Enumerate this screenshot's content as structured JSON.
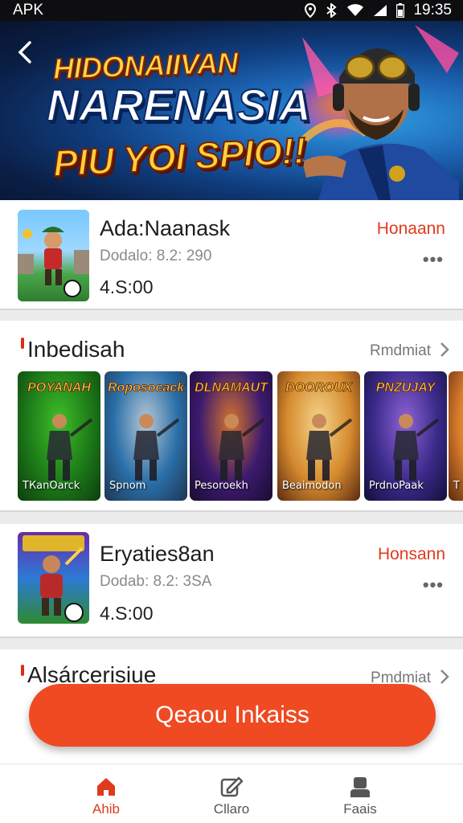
{
  "status_bar": {
    "carrier": "APK",
    "time": "19:35"
  },
  "hero": {
    "line1": "HIDONAIIVAN",
    "line2": "NARENASIA",
    "line3": "PIU YOI SPIO!!"
  },
  "featured_app": {
    "name": "Ada:Naanask",
    "meta": "Dodalo: 8.2: 290",
    "rating": "4.S:00",
    "action": "Honaann",
    "more": "•••"
  },
  "section1": {
    "title": "Inbedisah",
    "link": "Rmdmiat",
    "tiles": [
      {
        "title": "POYANAH",
        "label": "ТКanOarck",
        "colors": [
          "#1d7a18",
          "#3fbf2a",
          "#0d3d10"
        ]
      },
      {
        "title": "Roposocack",
        "label": "Spnom",
        "colors": [
          "#2a6fa8",
          "#b6c7d6",
          "#1e3550"
        ]
      },
      {
        "title": "DLNAMAUT",
        "label": "Pesoroekh",
        "colors": [
          "#3c1a6e",
          "#d8742a",
          "#1a0d30"
        ]
      },
      {
        "title": "DOOROUX",
        "label": "Beaimodon",
        "colors": [
          "#d68a2e",
          "#f3d58a",
          "#5a2a10"
        ]
      },
      {
        "title": "PNZUJAY",
        "label": "PrdnoPaak",
        "colors": [
          "#3b2a8a",
          "#8e63d6",
          "#12103a"
        ]
      },
      {
        "title": "",
        "label": "Т",
        "colors": [
          "#d87a2a",
          "#f4c070",
          "#5a2a10"
        ]
      }
    ]
  },
  "second_app": {
    "name": "Eryaties8an",
    "meta": "Dodab: 8.2: 3SA",
    "rating": "4.S:00",
    "action": "Honsann",
    "more": "•••"
  },
  "section2": {
    "title": "Alsárcerisiue",
    "link": "Pmdmiat"
  },
  "cta": {
    "label": "Qeaou Inkaiss"
  },
  "nav": [
    {
      "label": "Ahib",
      "icon": "home-icon"
    },
    {
      "label": "Cllaro",
      "icon": "edit-icon"
    },
    {
      "label": "Faais",
      "icon": "profile-icon"
    }
  ],
  "colors": {
    "accent": "#e03a1e",
    "cta": "#ef4a22",
    "hero_blue": "#1e68b8"
  }
}
